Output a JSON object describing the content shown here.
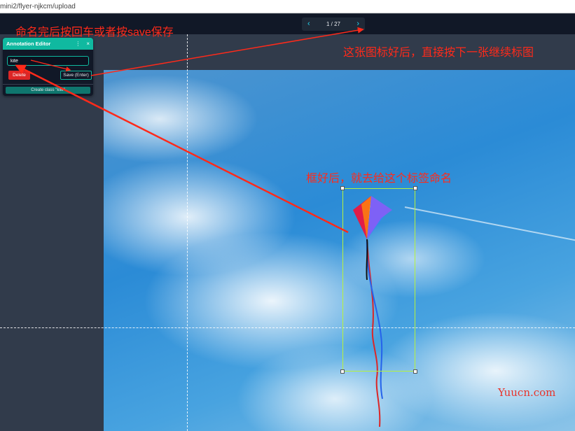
{
  "browser": {
    "url": "mini2/flyer-njkcm/upload"
  },
  "pager": {
    "prev_icon": "chevron-left-icon",
    "next_icon": "chevron-right-icon",
    "count": "1 / 27",
    "accent": "#22d3ee"
  },
  "editor": {
    "title": "Annotation Editor",
    "menu_glyph": "⋮",
    "close_glyph": "×",
    "label_value": "kite",
    "delete_label": "Delete",
    "save_label": "Save (Enter)",
    "create_label": "Create class \"kite\"",
    "accent": "#10b9a0"
  },
  "bbox": {
    "label": "kite",
    "color": "#b6f23c"
  },
  "annotations": {
    "top_left": "命名完后按回车或者按save保存",
    "top_right": "这张图标好后，直接按下一张继续标图",
    "middle": "框好后，就去给这个标签命名",
    "color": "#ff2a1a"
  },
  "watermark": "Yuucn.com"
}
